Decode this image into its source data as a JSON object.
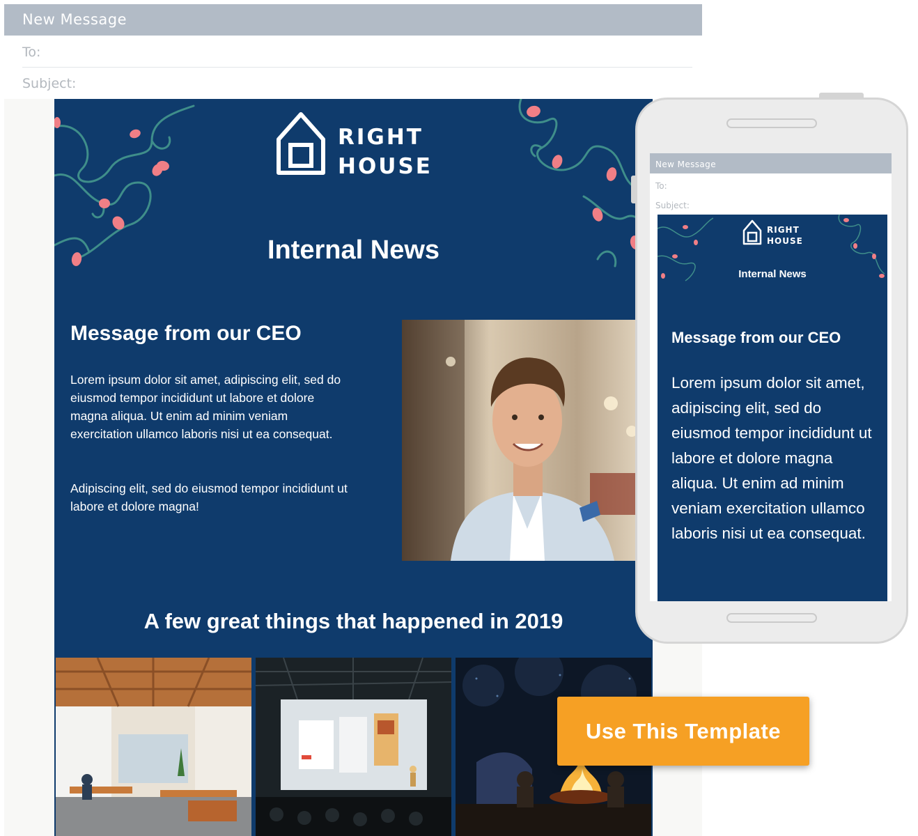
{
  "compose": {
    "title": "New Message",
    "to_label": "To:",
    "subject_label": "Subject:"
  },
  "email": {
    "brand": {
      "line1": "RIGHT",
      "line2": "HOUSE"
    },
    "title": "Internal News",
    "ceo_heading": "Message from our CEO",
    "ceo_paragraph_1": "Lorem ipsum dolor sit amet, adipiscing elit, sed do eiusmod tempor incididunt ut labore et dolore magna aliqua. Ut enim ad minim veniam exercitation ullamco laboris nisi ut ea consequat.",
    "ceo_paragraph_2": "Adipiscing elit, sed do eiusmod tempor incididunt ut labore et dolore magna!",
    "highlights_heading": "A few great things that happened in 2019",
    "thumbnails": [
      "office-photo",
      "presentation-stage-photo",
      "campfire-photo"
    ]
  },
  "mobile": {
    "compose_title": "New Message",
    "to_label": "To:",
    "subject_label": "Subject:",
    "brand": {
      "line1": "RIGHT",
      "line2": "HOUSE"
    },
    "title": "Internal News",
    "ceo_heading": "Message from our CEO",
    "ceo_paragraph": "Lorem ipsum dolor sit amet, adipiscing elit, sed do eiusmod tempor incididunt ut labore et dolore magna aliqua. Ut enim ad minim veniam exercitation ullamco laboris nisi ut ea consequat."
  },
  "cta": {
    "label": "Use This Template"
  },
  "colors": {
    "email_background": "#0f3b6c",
    "compose_bar": "#b2bbc6",
    "cta_background": "#f6a024",
    "vine": "#3f8e8a",
    "bulb": "#f07f86"
  }
}
